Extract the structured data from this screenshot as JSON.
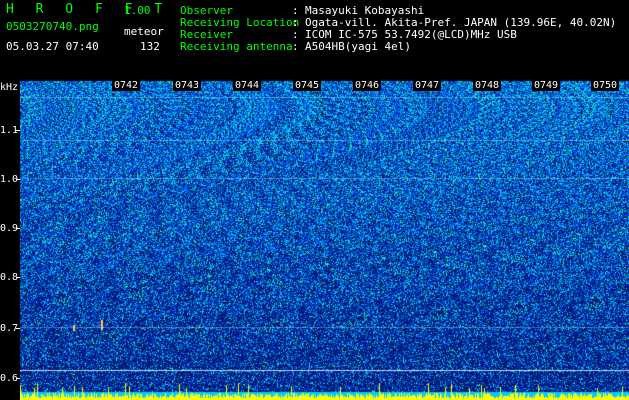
{
  "header": {
    "app_title": "H R O F F T",
    "version": "1.00",
    "filename": "0503270740.png",
    "mode_label": "meteor",
    "datetime": "05.03.27 07:40",
    "count": "132",
    "info": [
      {
        "label": "Observer",
        "value": "Masayuki Kobayashi"
      },
      {
        "label": "Receiving Location",
        "value": "Ogata-vill. Akita-Pref. JAPAN (139.96E, 40.02N)"
      },
      {
        "label": "Receiver",
        "value": "ICOM IC-575 53.7492(@LCD)MHz USB"
      },
      {
        "label": "Receiving antenna",
        "value": "A504HB(yagi 4el)"
      }
    ]
  },
  "plot": {
    "y_unit": "kHz",
    "y_ticks": [
      "1.1",
      "1.0",
      "0.9",
      "0.8",
      "0.7",
      "0.6"
    ],
    "x_ticks": [
      "0742",
      "0743",
      "0744",
      "0745",
      "0746",
      "0747",
      "0748",
      "0749",
      "0750"
    ]
  },
  "colors": {
    "label_green": "#00ff00",
    "text_white": "#ffffff",
    "noise_dark": "#00206a",
    "noise_bright": "#00c8ff",
    "signal_yellow": "#ffff00"
  }
}
